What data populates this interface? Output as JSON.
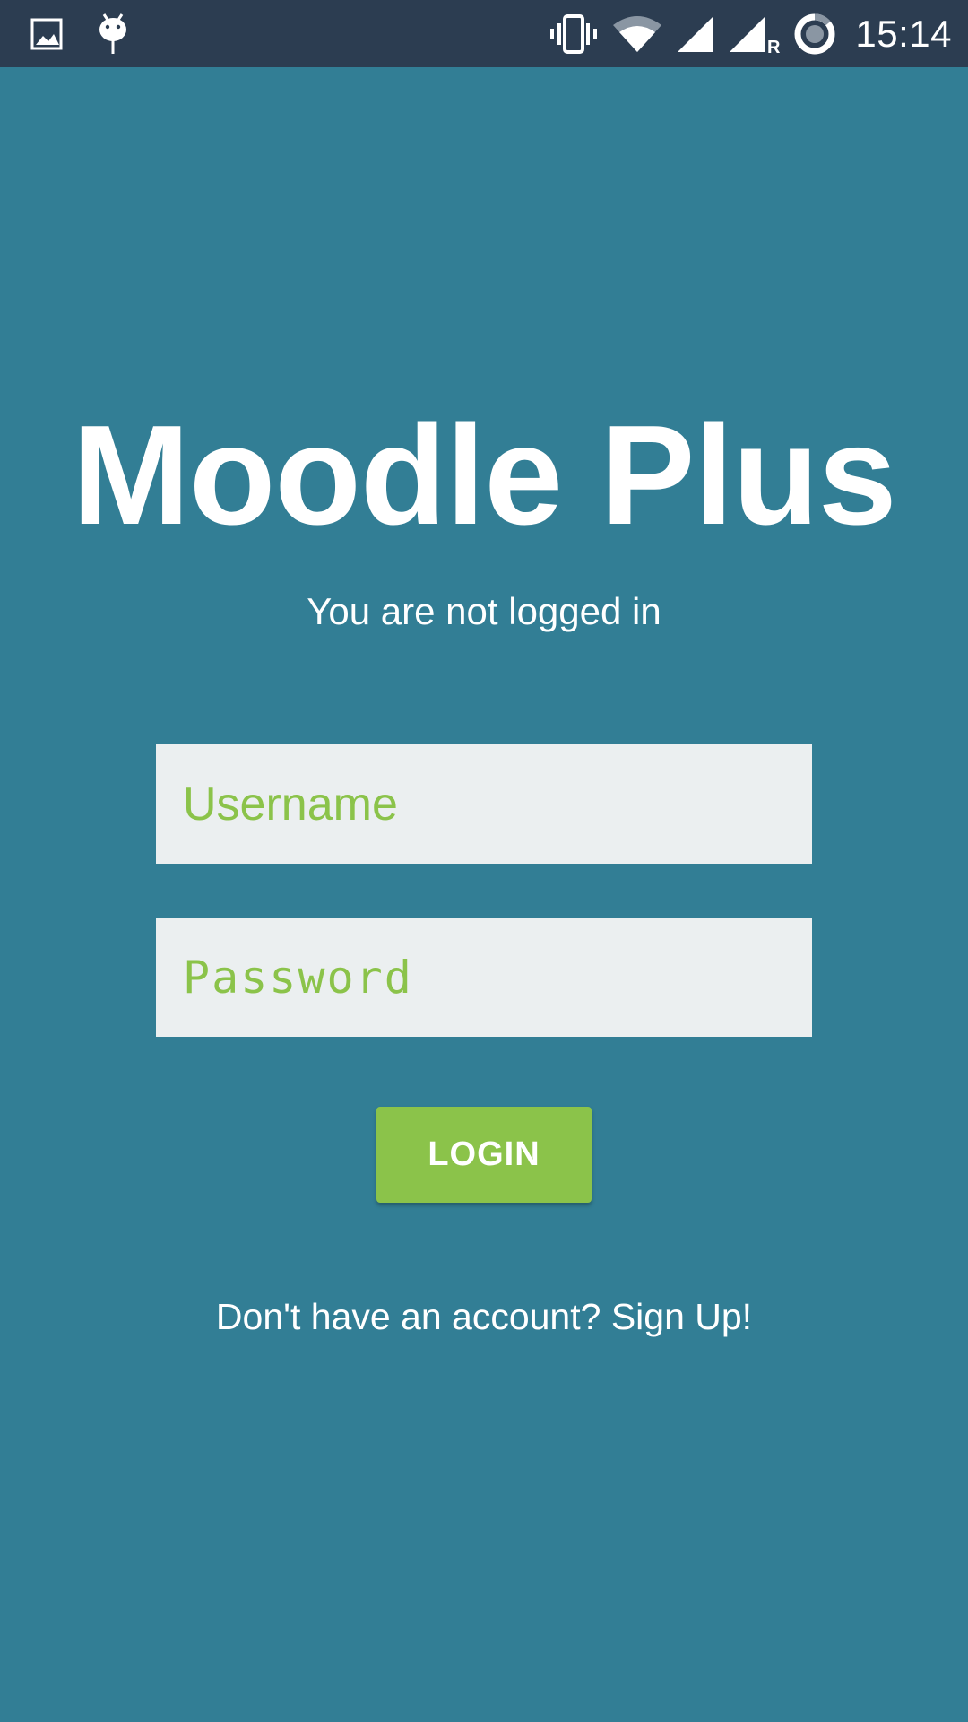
{
  "status_bar": {
    "time": "15:14",
    "roaming_indicator": "R",
    "left_icons": [
      "image-notification-icon",
      "android-debug-icon"
    ],
    "right_icons": [
      "vibrate-icon",
      "wifi-icon",
      "cell-signal-icon",
      "cell-signal-roaming-icon",
      "battery-charging-icon"
    ]
  },
  "app": {
    "title": "Moodle Plus",
    "login_status": "You are not logged in"
  },
  "form": {
    "username_placeholder": "Username",
    "password_placeholder": "Password",
    "login_label": "LOGIN",
    "signup_text": "Don't have an account? Sign Up!"
  },
  "colors": {
    "background": "#327e95",
    "status_bar": "#2c3d51",
    "accent_green": "#8bc34a",
    "field_background": "#ebeff0",
    "text": "#ffffff"
  }
}
